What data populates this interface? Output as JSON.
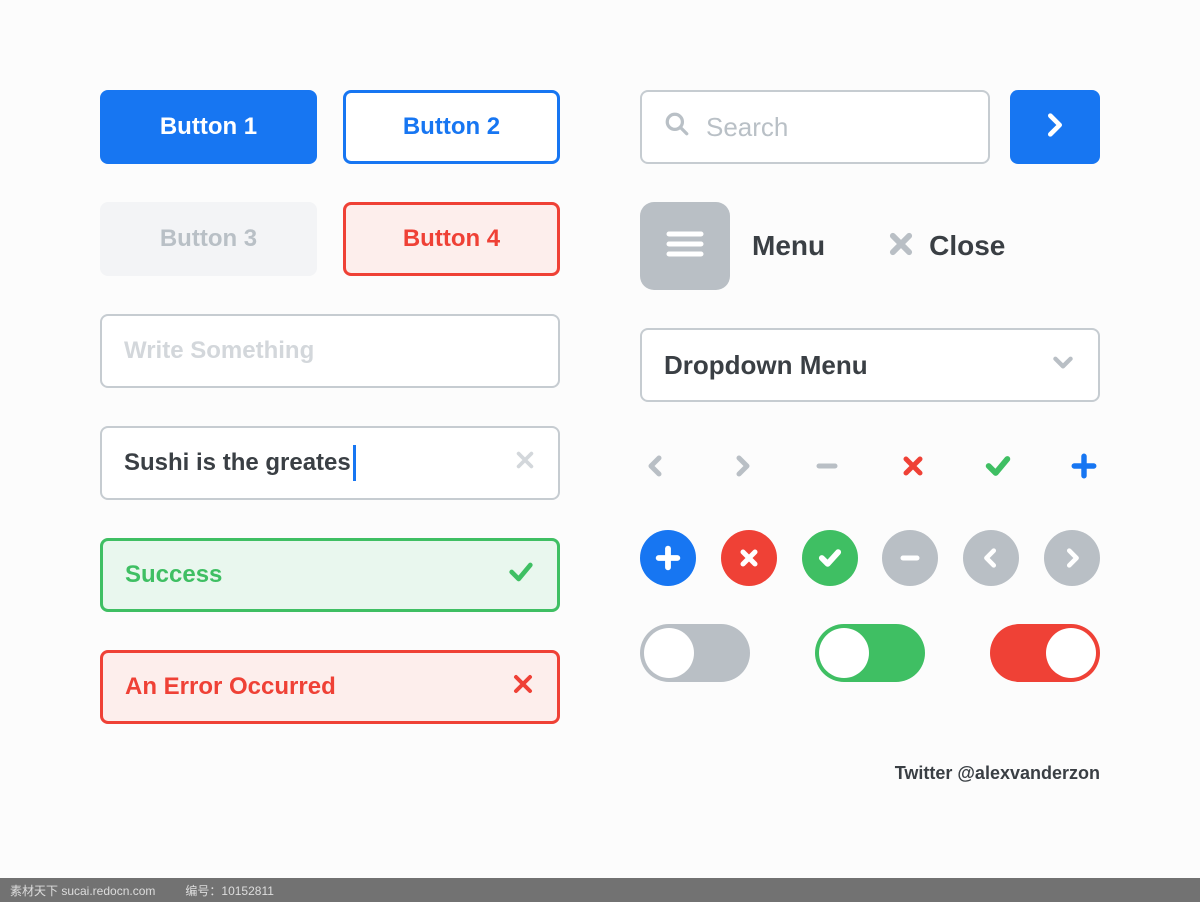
{
  "buttons": {
    "b1": "Button 1",
    "b2": "Button 2",
    "b3": "Button 3",
    "b4": "Button 4"
  },
  "inputs": {
    "write_placeholder": "Write Something",
    "typed_value": "Sushi is the greates"
  },
  "status": {
    "success": "Success",
    "error": "An Error Occurred"
  },
  "search": {
    "placeholder": "Search"
  },
  "menu": {
    "menu_label": "Menu",
    "close_label": "Close"
  },
  "dropdown": {
    "label": "Dropdown Menu"
  },
  "credit": "Twitter @alexvanderzon",
  "footer": {
    "site": "素材天下 sucai.redocn.com",
    "id_label": "编号：",
    "id_value": "10152811"
  },
  "colors": {
    "blue": "#1776f2",
    "red": "#ef4136",
    "green": "#3fbf63",
    "gray": "#b9bfc5"
  }
}
